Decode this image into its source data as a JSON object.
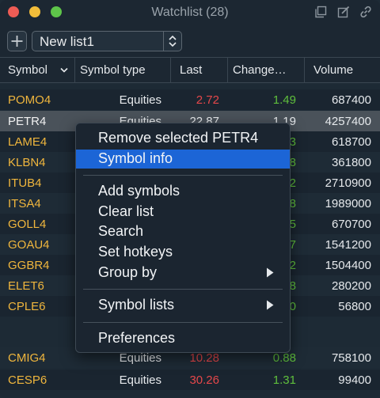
{
  "window": {
    "title": "Watchlist (28)"
  },
  "toolbar": {
    "list_name": "New list1"
  },
  "columns": {
    "symbol": "Symbol",
    "symbol_type": "Symbol type",
    "last": "Last",
    "change": "Change…",
    "volume": "Volume"
  },
  "rows": [
    {
      "symbol": "POMO4",
      "type": "Equities",
      "last": "2.72",
      "last_color": "red",
      "change": "1.49",
      "volume": "687400"
    },
    {
      "symbol": "PETR4",
      "type": "Equities",
      "last": "22.87",
      "last_color": "white",
      "change": "1.19",
      "volume": "4257400",
      "selected": true
    },
    {
      "symbol": "LAME4",
      "type": "",
      "last": "",
      "last_color": "white",
      "change": "23",
      "volume": "618700"
    },
    {
      "symbol": "KLBN4",
      "type": "",
      "last": "",
      "last_color": "white",
      "change": "78",
      "volume": "361800"
    },
    {
      "symbol": "ITUB4",
      "type": "",
      "last": "",
      "last_color": "white",
      "change": "72",
      "volume": "2710900"
    },
    {
      "symbol": "ITSA4",
      "type": "",
      "last": "",
      "last_color": "white",
      "change": "18",
      "volume": "1989000"
    },
    {
      "symbol": "GOLL4",
      "type": "",
      "last": "",
      "last_color": "white",
      "change": "55",
      "volume": "670700"
    },
    {
      "symbol": "GOAU4",
      "type": "",
      "last": "",
      "last_color": "white",
      "change": "57",
      "volume": "1541200"
    },
    {
      "symbol": "GGBR4",
      "type": "",
      "last": "",
      "last_color": "white",
      "change": "22",
      "volume": "1504400"
    },
    {
      "symbol": "ELET6",
      "type": "",
      "last": "",
      "last_color": "white",
      "change": "78",
      "volume": "280200"
    },
    {
      "symbol": "CPLE6",
      "type": "",
      "last": "",
      "last_color": "white",
      "change": "50",
      "volume": "56800"
    },
    {
      "symbol": "CMIG4",
      "type": "Equities",
      "last": "10.28",
      "last_color": "red",
      "change": "0.88",
      "volume": "758100"
    },
    {
      "symbol": "CESP6",
      "type": "Equities",
      "last": "30.26",
      "last_color": "red",
      "change": "1.31",
      "volume": "99400"
    }
  ],
  "context_menu": {
    "items": [
      {
        "label": "Remove selected PETR4"
      },
      {
        "label": "Symbol info",
        "highlighted": true
      },
      {
        "label": "Add symbols"
      },
      {
        "label": "Clear list"
      },
      {
        "label": "Search"
      },
      {
        "label": "Set hotkeys"
      },
      {
        "label": "Group by",
        "submenu": true
      },
      {
        "label": "Symbol lists",
        "submenu": true
      },
      {
        "label": "Preferences"
      }
    ]
  },
  "colors": {
    "background": "#1d2a35",
    "symbol": "#f0b63d",
    "negative": "#e5474a",
    "positive": "#5fbf3c",
    "menu_highlight": "#1c65d6",
    "selected_row": "#4a525a"
  },
  "icons": {
    "window_buttons": [
      "copy-icon",
      "edit-icon",
      "link-icon"
    ],
    "add": "plus-icon",
    "select_arrows": "up-down-chevron-icon",
    "sort": "chevron-down-icon",
    "submenu": "triangle-right-icon"
  }
}
